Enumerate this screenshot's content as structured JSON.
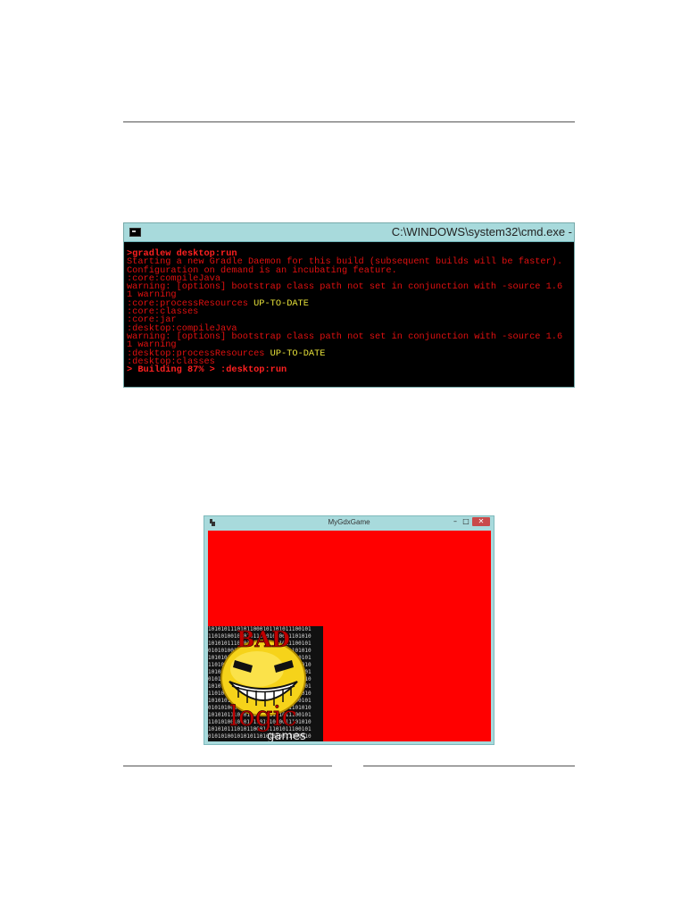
{
  "cmd_window": {
    "title": "C:\\WINDOWS\\system32\\cmd.exe -",
    "lines": [
      {
        "text": ">gradlew desktop:run",
        "bold": true
      },
      {
        "text": "Starting a new Gradle Daemon for this build (subsequent builds will be faster)."
      },
      {
        "text": "Configuration on demand is an incubating feature."
      },
      {
        "text": ":core:compileJava"
      },
      {
        "text": "warning: [options] bootstrap class path not set in conjunction with -source 1.6"
      },
      {
        "text": "1 warning"
      },
      {
        "text": ":core:processResources ",
        "suffix": "UP-TO-DATE"
      },
      {
        "text": ":core:classes"
      },
      {
        "text": ":core:jar"
      },
      {
        "text": ":desktop:compileJava"
      },
      {
        "text": "warning: [options] bootstrap class path not set in conjunction with -source 1.6"
      },
      {
        "text": "1 warning"
      },
      {
        "text": ":desktop:processResources ",
        "suffix": "UP-TO-DATE"
      },
      {
        "text": ":desktop:classes"
      },
      {
        "text": "> Building 87% > :desktop:run",
        "bold": true
      }
    ],
    "colors": {
      "text": "#e21010",
      "highlight": "#e8e23a",
      "background": "#000000",
      "titlebar": "#a8dadc"
    }
  },
  "game_window": {
    "title": "MyGdxGame",
    "minimize_glyph": "–",
    "maximize_glyph": "□",
    "close_glyph": "✕",
    "canvas_color": "#ff0000",
    "logo": {
      "word1": "BAD",
      "word2": "logic",
      "word3": "games",
      "binary_rows": [
        "10101011101011000101101011100101",
        "11010100101010110101010011101010",
        "10101011101011000101101011100101",
        "01010100101010110101010011101010",
        "10101011101011000101101011100101",
        "11010100101010110101010011101010",
        "10101011101011000101101011100101",
        "01010100101010110101010011101010",
        "10101011101011000101101011100101",
        "11010100101010110101010011101010",
        "10101011101011000101101011100101",
        "01010100101010110101010011101010",
        "10101011101011000101101011100101",
        "11010100101010110101010011101010",
        "10101011101011000101101011100101",
        "01010100101010110101010011101010"
      ]
    }
  }
}
